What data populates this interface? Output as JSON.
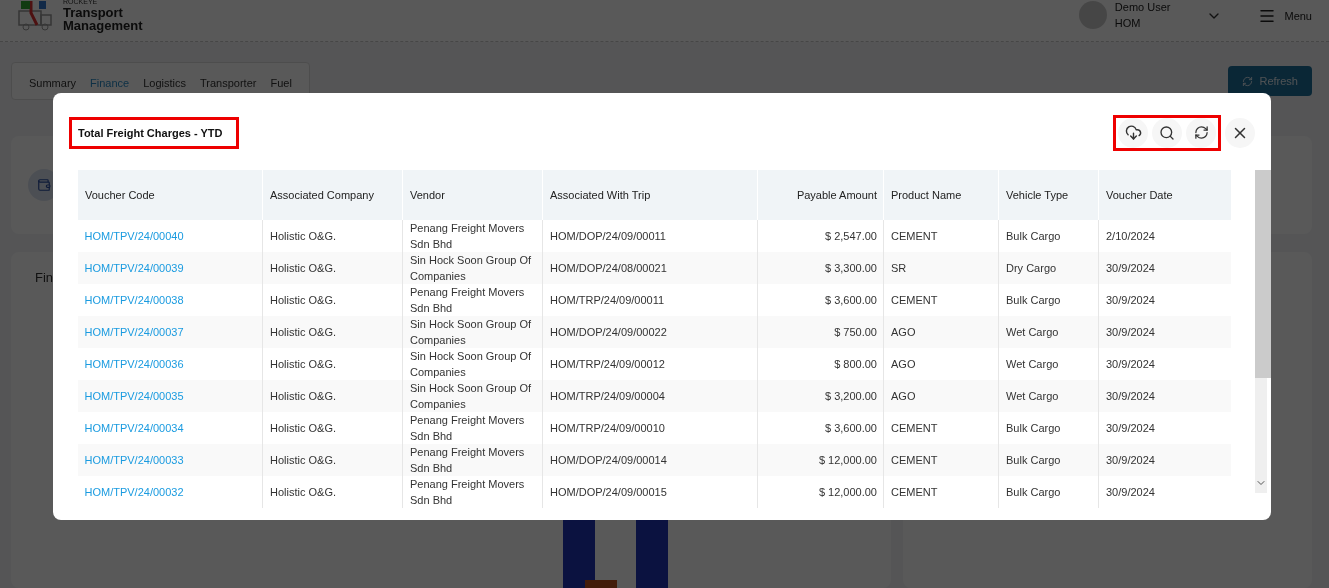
{
  "header": {
    "brand_small": "ROCKEYE",
    "brand": "Transport Management",
    "user_name": "Demo User",
    "user_org": "HOM",
    "menu_label": "Menu"
  },
  "tabs": [
    {
      "label": "Summary",
      "selected": false
    },
    {
      "label": "Finance",
      "selected": true
    },
    {
      "label": "Logistics",
      "selected": false
    },
    {
      "label": "Transporter",
      "selected": false
    },
    {
      "label": "Fuel",
      "selected": false
    }
  ],
  "refresh_button": "Refresh",
  "background_card_title": "Fin",
  "modal": {
    "title": "Total Freight Charges - YTD",
    "columns": [
      {
        "label": "Voucher Code",
        "kind": "link"
      },
      {
        "label": "Associated Company",
        "kind": "text"
      },
      {
        "label": "Vendor",
        "kind": "text"
      },
      {
        "label": "Associated With Trip",
        "kind": "text"
      },
      {
        "label": "Payable Amount",
        "kind": "amount"
      },
      {
        "label": "Product Name",
        "kind": "text"
      },
      {
        "label": "Vehicle Type",
        "kind": "text"
      },
      {
        "label": "Voucher Date",
        "kind": "text"
      }
    ],
    "rows": [
      [
        "HOM/TPV/24/00040",
        "Holistic O&G.",
        "Penang Freight Movers Sdn Bhd",
        "HOM/DOP/24/09/00011",
        "$ 2,547.00",
        "CEMENT",
        "Bulk Cargo",
        "2/10/2024"
      ],
      [
        "HOM/TPV/24/00039",
        "Holistic O&G.",
        "Sin Hock Soon Group Of Companies",
        "HOM/DOP/24/08/00021",
        "$ 3,300.00",
        "SR",
        "Dry Cargo",
        "30/9/2024"
      ],
      [
        "HOM/TPV/24/00038",
        "Holistic O&G.",
        "Penang Freight Movers Sdn Bhd",
        "HOM/TRP/24/09/00011",
        "$ 3,600.00",
        "CEMENT",
        "Bulk Cargo",
        "30/9/2024"
      ],
      [
        "HOM/TPV/24/00037",
        "Holistic O&G.",
        "Sin Hock Soon Group Of Companies",
        "HOM/DOP/24/09/00022",
        "$ 750.00",
        "AGO",
        "Wet Cargo",
        "30/9/2024"
      ],
      [
        "HOM/TPV/24/00036",
        "Holistic O&G.",
        "Sin Hock Soon Group Of Companies",
        "HOM/TRP/24/09/00012",
        "$ 800.00",
        "AGO",
        "Wet Cargo",
        "30/9/2024"
      ],
      [
        "HOM/TPV/24/00035",
        "Holistic O&G.",
        "Sin Hock Soon Group Of Companies",
        "HOM/TRP/24/09/00004",
        "$ 3,200.00",
        "AGO",
        "Wet Cargo",
        "30/9/2024"
      ],
      [
        "HOM/TPV/24/00034",
        "Holistic O&G.",
        "Penang Freight Movers Sdn Bhd",
        "HOM/TRP/24/09/00010",
        "$ 3,600.00",
        "CEMENT",
        "Bulk Cargo",
        "30/9/2024"
      ],
      [
        "HOM/TPV/24/00033",
        "Holistic O&G.",
        "Penang Freight Movers Sdn Bhd",
        "HOM/DOP/24/09/00014",
        "$ 12,000.00",
        "CEMENT",
        "Bulk Cargo",
        "30/9/2024"
      ],
      [
        "HOM/TPV/24/00032",
        "Holistic O&G.",
        "Penang Freight Movers Sdn Bhd",
        "HOM/DOP/24/09/00015",
        "$ 12,000.00",
        "CEMENT",
        "Bulk Cargo",
        "30/9/2024"
      ]
    ]
  }
}
